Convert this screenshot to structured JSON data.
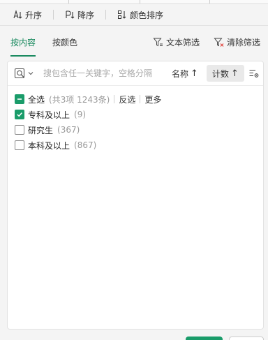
{
  "sort_toolbar": {
    "ascending": "升序",
    "descending": "降序",
    "color_sort": "颜色排序"
  },
  "tabs": {
    "by_content": "按内容",
    "by_color": "按颜色"
  },
  "tools": {
    "text_filter": "文本筛选",
    "clear_filter": "清除筛选"
  },
  "search": {
    "placeholder": "搜包含任一关键字，空格分隔",
    "sort_by_name": "名称",
    "sort_by_count": "计数",
    "arrow": "↑"
  },
  "select_all": {
    "label": "全选",
    "summary": "(共3项 1243条)",
    "invert": "反选",
    "more": "更多",
    "state": "partial"
  },
  "items": [
    {
      "label": "专科及以上",
      "count": "(9)",
      "checked": true
    },
    {
      "label": "研究生",
      "count": "(367)",
      "checked": false
    },
    {
      "label": "本科及以上",
      "count": "(867)",
      "checked": false
    }
  ],
  "colors": {
    "accent": "#1a9c6a",
    "tab_active": "#1a8a5f",
    "clear_icon_x": "#e0443c"
  }
}
